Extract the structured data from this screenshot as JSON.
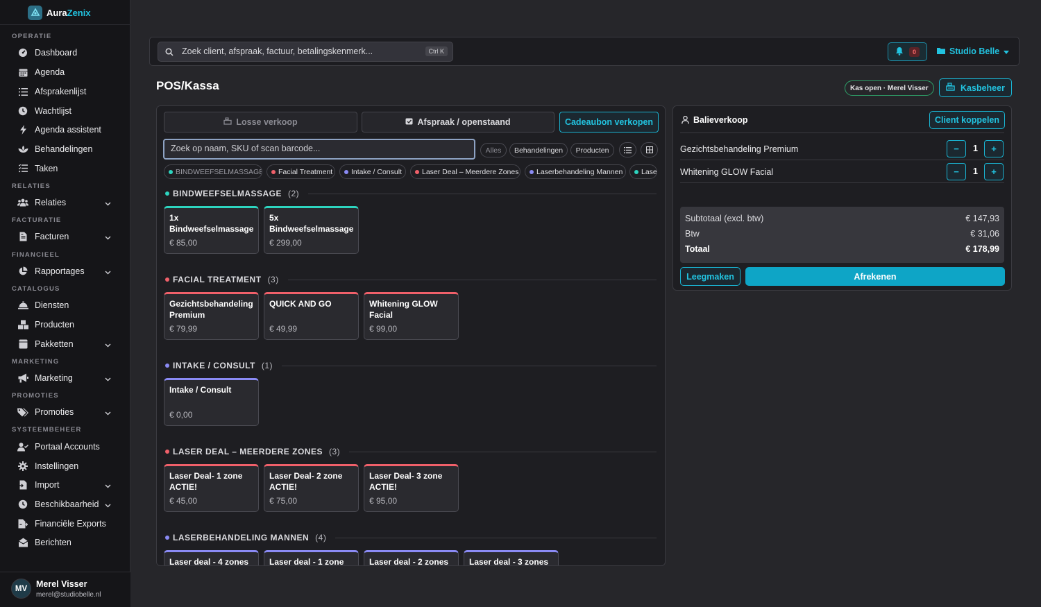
{
  "app": {
    "name_a": "Aura",
    "name_b": "Zenix"
  },
  "sidebar": {
    "sections": [
      {
        "label": "OPERATIE"
      },
      {
        "label": "RELATIES"
      },
      {
        "label": "FACTURATIE"
      },
      {
        "label": "FINANCIEEL"
      },
      {
        "label": "CATALOGUS"
      },
      {
        "label": "MARKETING"
      },
      {
        "label": "PROMOTIES"
      },
      {
        "label": "SYSTEEMBEHEER"
      }
    ],
    "items": [
      {
        "label": "Dashboard",
        "icon": "dashboard-icon"
      },
      {
        "label": "Agenda",
        "icon": "calendar-icon"
      },
      {
        "label": "Afsprakenlijst",
        "icon": "list-icon"
      },
      {
        "label": "Wachtlijst",
        "icon": "clock-icon"
      },
      {
        "label": "Agenda assistent",
        "icon": "bolt-icon"
      },
      {
        "label": "Behandelingen",
        "icon": "spa-icon"
      },
      {
        "label": "Taken",
        "icon": "tasks-icon"
      },
      {
        "label": "Relaties",
        "icon": "users-icon",
        "expandable": true
      },
      {
        "label": "Facturen",
        "icon": "invoice-icon",
        "expandable": true
      },
      {
        "label": "Rapportages",
        "icon": "pie-chart-icon",
        "expandable": true
      },
      {
        "label": "Diensten",
        "icon": "bell-service-icon"
      },
      {
        "label": "Producten",
        "icon": "boxes-icon"
      },
      {
        "label": "Pakketten",
        "icon": "package-icon",
        "expandable": true
      },
      {
        "label": "Marketing",
        "icon": "megaphone-icon",
        "expandable": true
      },
      {
        "label": "Promoties",
        "icon": "tags-icon",
        "expandable": true
      },
      {
        "label": "Portaal Accounts",
        "icon": "user-check-icon"
      },
      {
        "label": "Instellingen",
        "icon": "gear-icon"
      },
      {
        "label": "Import",
        "icon": "file-import-icon",
        "expandable": true
      },
      {
        "label": "Beschikbaarheid",
        "icon": "clock-icon",
        "expandable": true
      },
      {
        "label": "Financiële Exports",
        "icon": "file-export-icon"
      },
      {
        "label": "Berichten",
        "icon": "message-icon"
      }
    ],
    "user": {
      "initials": "MV",
      "name": "Merel Visser",
      "email": "merel@studiobelle.nl"
    }
  },
  "header": {
    "search_placeholder": "Zoek client, afspraak, factuur, betalingskenmerk...",
    "shortcut": "Ctrl K",
    "notifications": "0",
    "studio": "Studio Belle"
  },
  "page": {
    "title": "POS/Kassa",
    "kas_status": "Kas open · Merel Visser",
    "kasbeheer": "Kasbeheer"
  },
  "pos": {
    "tabs": [
      "Losse verkoop",
      "Afspraak / openstaand",
      "Cadeaubon verkopen"
    ],
    "product_search_placeholder": "Zoek op naam, SKU of scan barcode...",
    "filters": [
      "Alles",
      "Behandelingen",
      "Producten"
    ],
    "chips": [
      {
        "label": "BINDWEEFSELMASSAGE",
        "color": "#2dd4bf"
      },
      {
        "label": "Facial Treatment",
        "color": "#f0606a"
      },
      {
        "label": "Intake / Consult",
        "color": "#8b8bf5"
      },
      {
        "label": "Laser Deal – Meerdere Zones",
        "color": "#f0606a"
      },
      {
        "label": "Laserbehandeling Mannen",
        "color": "#8b8bf5"
      },
      {
        "label": "Laser",
        "color": "#2dd4bf"
      }
    ],
    "categories": [
      {
        "name": "BINDWEEFSELMASSAGE",
        "count": "(2)",
        "color": "#2dd4bf",
        "items": [
          {
            "name": "1x Bindweefselmassage",
            "price": "€ 85,00"
          },
          {
            "name": "5x Bindweefselmassage",
            "price": "€ 299,00"
          }
        ]
      },
      {
        "name": "FACIAL TREATMENT",
        "count": "(3)",
        "color": "#f0606a",
        "items": [
          {
            "name": "Gezichtsbehandeling Premium",
            "price": "€ 79,99"
          },
          {
            "name": "QUICK AND GO",
            "price": "€ 49,99"
          },
          {
            "name": "Whitening GLOW Facial",
            "price": "€ 99,00"
          }
        ]
      },
      {
        "name": "INTAKE / CONSULT",
        "count": "(1)",
        "color": "#8b8bf5",
        "items": [
          {
            "name": "Intake / Consult",
            "price": "€ 0,00"
          }
        ]
      },
      {
        "name": "LASER DEAL – MEERDERE ZONES",
        "count": "(3)",
        "color": "#f0606a",
        "items": [
          {
            "name": "Laser Deal- 1 zone ACTIE!",
            "price": "€ 45,00"
          },
          {
            "name": "Laser Deal- 2 zone ACTIE!",
            "price": "€ 75,00"
          },
          {
            "name": "Laser Deal- 3 zone ACTIE!",
            "price": "€ 95,00"
          }
        ]
      },
      {
        "name": "LASERBEHANDELING MANNEN",
        "count": "(4)",
        "color": "#8b8bf5",
        "items": [
          {
            "name": "Laser deal - 4 zones",
            "price": ""
          },
          {
            "name": "Laser deal - 1 zone",
            "price": ""
          },
          {
            "name": "Laser deal - 2 zones",
            "price": ""
          },
          {
            "name": "Laser deal - 3 zones",
            "price": ""
          }
        ]
      }
    ]
  },
  "cart": {
    "title": "Balieverkoop",
    "link_client": "Client koppelen",
    "lines": [
      {
        "name": "Gezichtsbehandeling Premium",
        "qty": "1"
      },
      {
        "name": "Whitening GLOW Facial",
        "qty": "1"
      }
    ],
    "minus": "−",
    "plus": "+",
    "subtotal_label": "Subtotaal (excl. btw)",
    "subtotal": "€ 147,93",
    "vat_label": "Btw",
    "vat": "€ 31,06",
    "total_label": "Totaal",
    "total": "€ 178,99",
    "clear": "Leegmaken",
    "checkout": "Afrekenen"
  },
  "colors": {
    "accent": "#22c3e0",
    "teal": "#2dd4bf",
    "coral": "#f0606a",
    "violet": "#8b8bf5",
    "success": "#2ea36a"
  }
}
